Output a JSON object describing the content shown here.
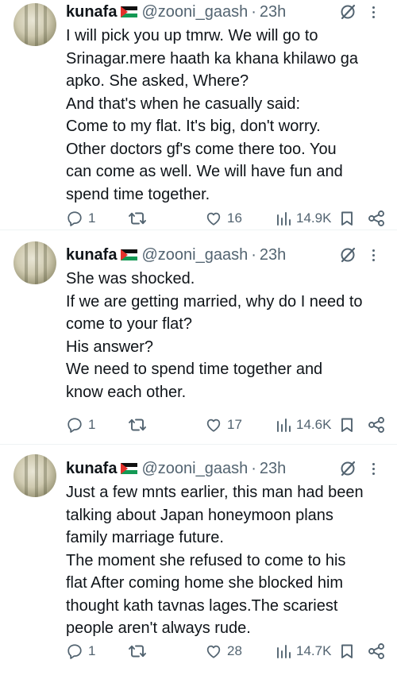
{
  "tweets": [
    {
      "name": "kunafa",
      "handle": "@zooni_gaash",
      "separator": "·",
      "time": "23h",
      "lines": [
        "I will pick you up tmrw. We will go to",
        "Srinagar.mere haath ka khana khilawo ga",
        "apko. She asked, Where?",
        "And that's when he casually said:",
        "Come to my flat. It's big, don't worry.",
        "Other doctors gf's come there too. You",
        "can come as well. We will have fun and",
        "spend time together."
      ],
      "replies": "1",
      "retweets": "",
      "likes": "16",
      "views": "14.9K"
    },
    {
      "name": "kunafa",
      "handle": "@zooni_gaash",
      "separator": "·",
      "time": "23h",
      "lines": [
        "She was shocked.",
        "If we are getting married, why do I need to",
        "come to your flat?",
        "His answer?",
        "We need to spend time together and",
        "know each other."
      ],
      "replies": "1",
      "retweets": "",
      "likes": "17",
      "views": "14.6K"
    },
    {
      "name": "kunafa",
      "handle": "@zooni_gaash",
      "separator": "·",
      "time": "23h",
      "lines": [
        "Just a few mnts earlier, this man had been",
        "talking about Japan honeymoon plans",
        "family marriage future.",
        "The moment she refused to come to his",
        "flat After coming home she blocked him",
        "thought kath tavnas lages.The scariest",
        "people aren't always rude."
      ],
      "replies": "1",
      "retweets": "",
      "likes": "28",
      "views": "14.7K"
    }
  ],
  "icons": {
    "reply": "reply-icon",
    "retweet": "retweet-icon",
    "like": "heart-icon",
    "views": "views-icon",
    "bookmark": "bookmark-icon",
    "share": "share-icon",
    "grok": "grok-icon",
    "more": "more-icon",
    "flag": "palestine-flag-icon"
  },
  "colors": {
    "text": "#0f1419",
    "muted": "#536471",
    "flag_red": "#e4312b",
    "flag_green": "#149954",
    "flag_black": "#111111"
  }
}
